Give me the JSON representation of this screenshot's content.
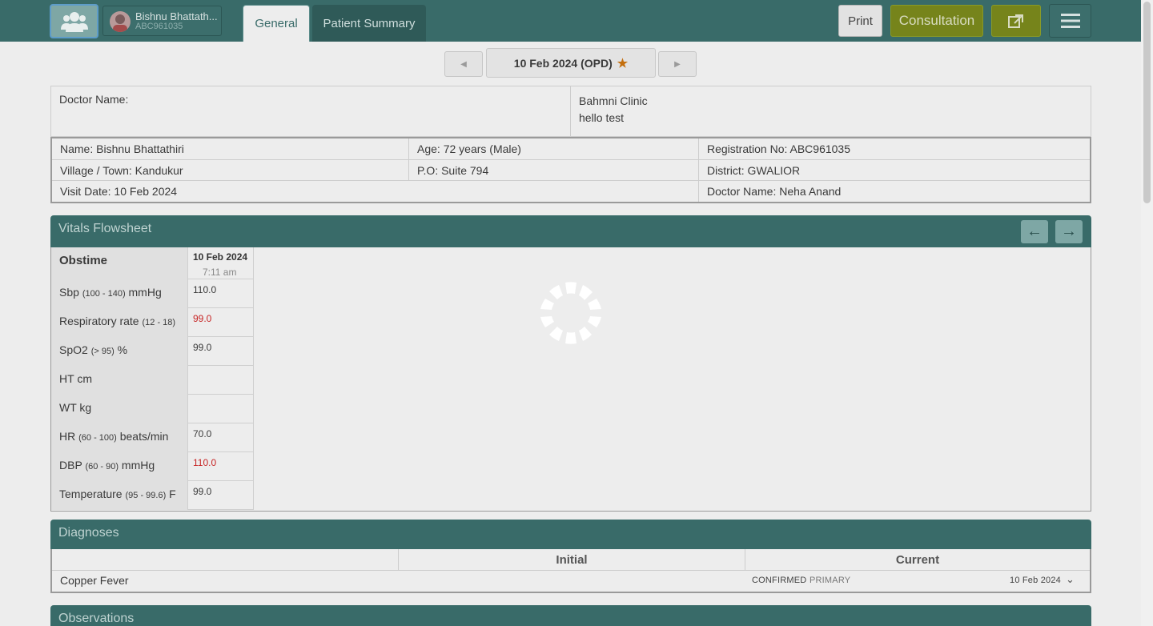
{
  "header": {
    "patient_name": "Bishnu Bhattath...",
    "patient_id": "ABC961035",
    "tabs": [
      "General",
      "Patient Summary"
    ],
    "print_label": "Print",
    "consultation_label": "Consultation"
  },
  "visit": {
    "date_label": "10 Feb 2024 (OPD)"
  },
  "info": {
    "doctor_name_label": "Doctor Name:",
    "clinic_name": "Bahmni Clinic",
    "clinic_note": "hello test",
    "name": "Name: Bishnu Bhattathiri",
    "age": "Age: 72 years (Male)",
    "registration": "Registration No: ABC961035",
    "village": "Village / Town: Kandukur",
    "po": "P.O: Suite 794",
    "district": "District: GWALIOR",
    "visit_date": "Visit Date: 10 Feb 2024",
    "doctor": "Doctor Name: Neha Anand"
  },
  "vitals": {
    "title": "Vitals Flowsheet",
    "obstime_label": "Obstime",
    "col_date": "10 Feb 2024",
    "col_time": "7:11 am",
    "rows": [
      {
        "name": "Sbp",
        "range": "(100 - 140)",
        "unit": "mmHg",
        "value": "110.0",
        "abnormal": false
      },
      {
        "name": "Respiratory rate",
        "range": "(12 - 18)",
        "unit": "",
        "value": "99.0",
        "abnormal": true
      },
      {
        "name": "SpO2",
        "range": "(> 95)",
        "unit": "%",
        "value": "99.0",
        "abnormal": false
      },
      {
        "name": "HT",
        "range": "",
        "unit": "cm",
        "value": "",
        "abnormal": false
      },
      {
        "name": "WT",
        "range": "",
        "unit": "kg",
        "value": "",
        "abnormal": false
      },
      {
        "name": "HR",
        "range": "(60 - 100)",
        "unit": "beats/min",
        "value": "70.0",
        "abnormal": false
      },
      {
        "name": "DBP",
        "range": "(60 - 90)",
        "unit": "mmHg",
        "value": "110.0",
        "abnormal": true
      },
      {
        "name": "Temperature",
        "range": "(95 - 99.6)",
        "unit": "F",
        "value": "99.0",
        "abnormal": false
      }
    ]
  },
  "diagnoses": {
    "title": "Diagnoses",
    "col_initial": "Initial",
    "col_current": "Current",
    "item_name": "Copper Fever",
    "certainty": "CONFIRMED",
    "order": "PRIMARY",
    "date": "10 Feb 2024"
  },
  "observations": {
    "title": "Observations"
  }
}
